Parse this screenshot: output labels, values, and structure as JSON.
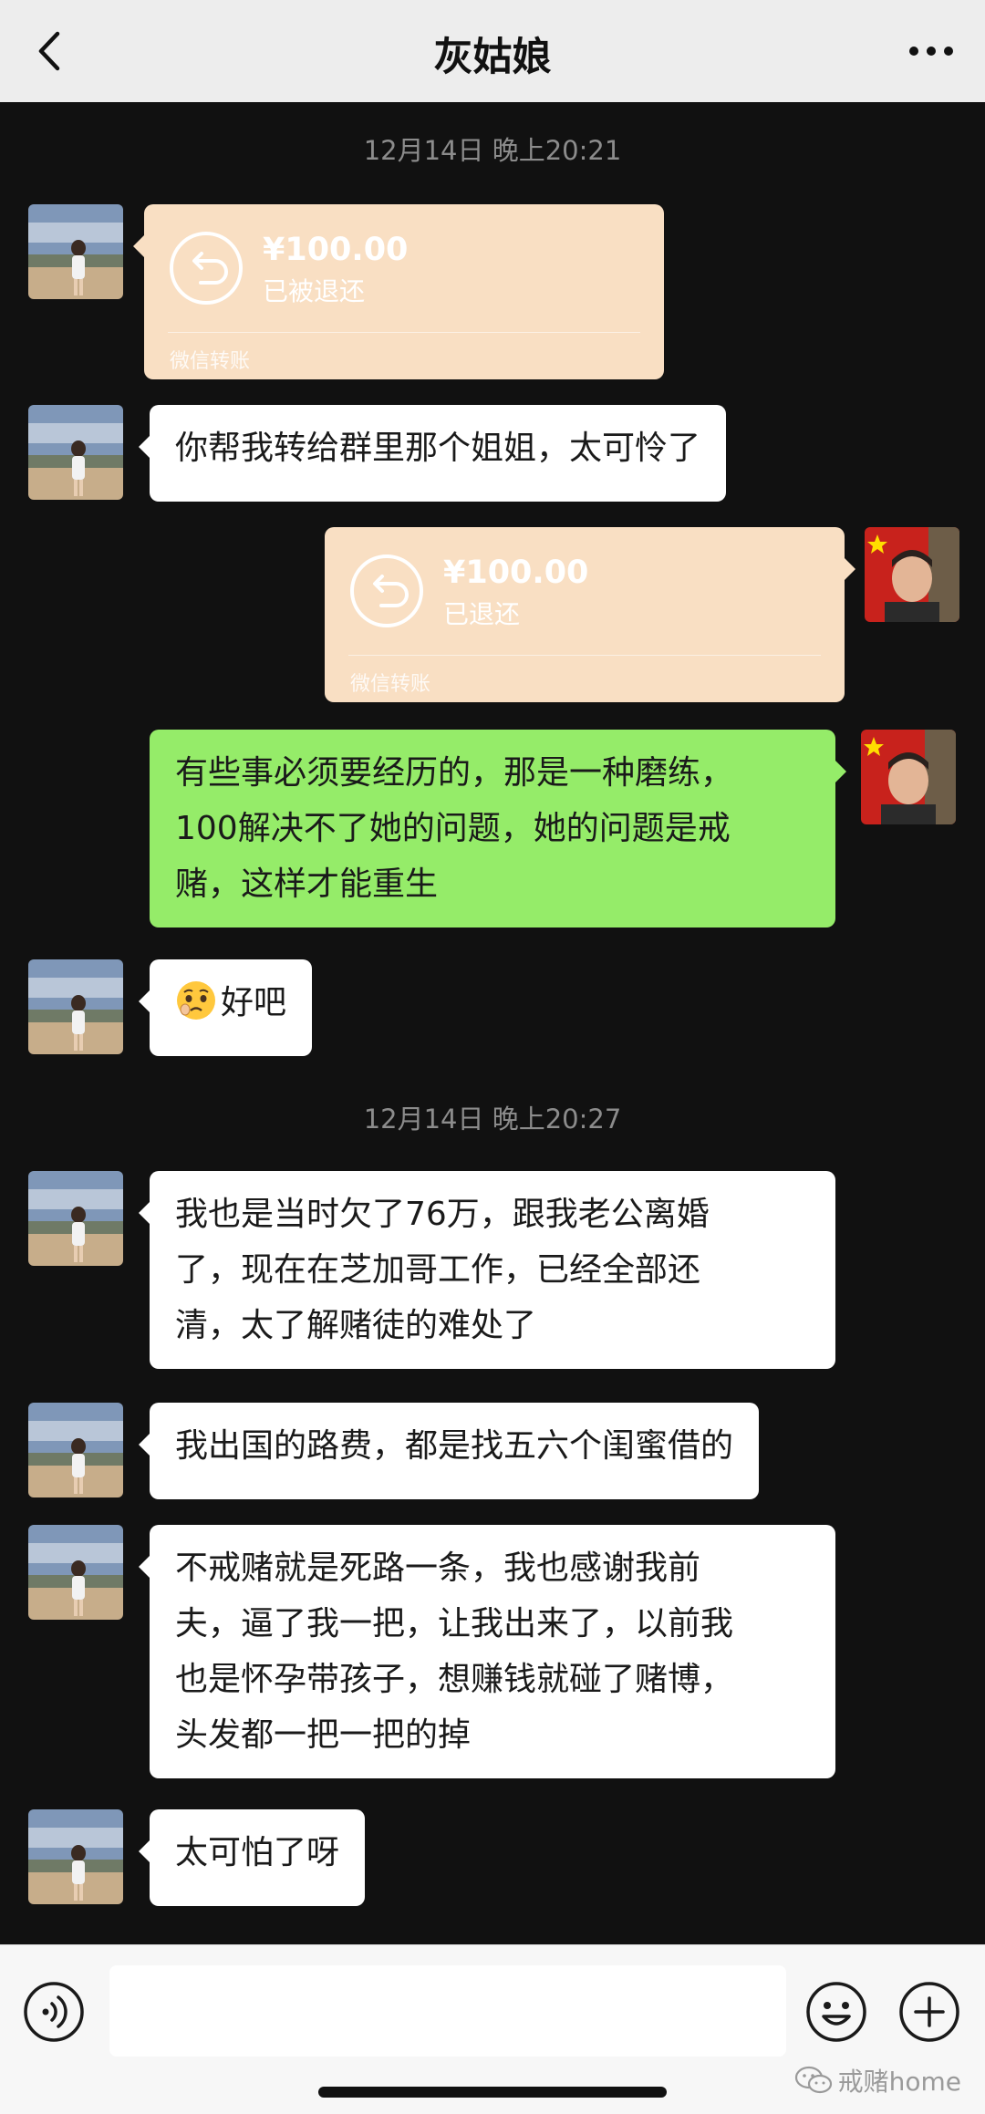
{
  "header": {
    "title": "灰姑娘"
  },
  "timestamps": [
    "12月14日 晚上20:21",
    "12月14日 晚上20:27"
  ],
  "messages": [
    {
      "side": "left",
      "kind": "transfer",
      "amount": "¥100.00",
      "status": "已被退还",
      "footer": "微信转账"
    },
    {
      "side": "left",
      "kind": "text",
      "text": "你帮我转给群里那个姐姐，太可怜了"
    },
    {
      "side": "right",
      "kind": "transfer",
      "amount": "¥100.00",
      "status": "已退还",
      "footer": "微信转账"
    },
    {
      "side": "right",
      "kind": "text",
      "lines": [
        "有些事必须要经历的，那是一种磨练，",
        "100解决不了她的问题，她的问题是戒",
        "赌，这样才能重生"
      ]
    },
    {
      "side": "left",
      "kind": "text",
      "emoji": "pleading-face-emoji",
      "text": "好吧"
    },
    {
      "side": "left",
      "kind": "text",
      "lines": [
        "我也是当时欠了76万，跟我老公离婚",
        "了，现在在芝加哥工作，已经全部还",
        "清，太了解赌徒的难处了"
      ]
    },
    {
      "side": "left",
      "kind": "text",
      "text": "我出国的路费，都是找五六个闺蜜借的"
    },
    {
      "side": "left",
      "kind": "text",
      "lines": [
        "不戒赌就是死路一条，我也感谢我前",
        "夫，逼了我一把，让我出来了，以前我",
        "也是怀孕带孩子，想赚钱就碰了赌博，",
        "头发都一把一把的掉"
      ]
    },
    {
      "side": "left",
      "kind": "text",
      "text": "太可怕了呀"
    }
  ],
  "input": {
    "placeholder": "",
    "value": ""
  },
  "watermark": {
    "text": "戒赌home"
  },
  "colors": {
    "header_bg": "#ededed",
    "chat_bg": "#111111",
    "bubble_white": "#ffffff",
    "bubble_green": "#95ec69",
    "transfer_bg": "#f9dfc3"
  }
}
